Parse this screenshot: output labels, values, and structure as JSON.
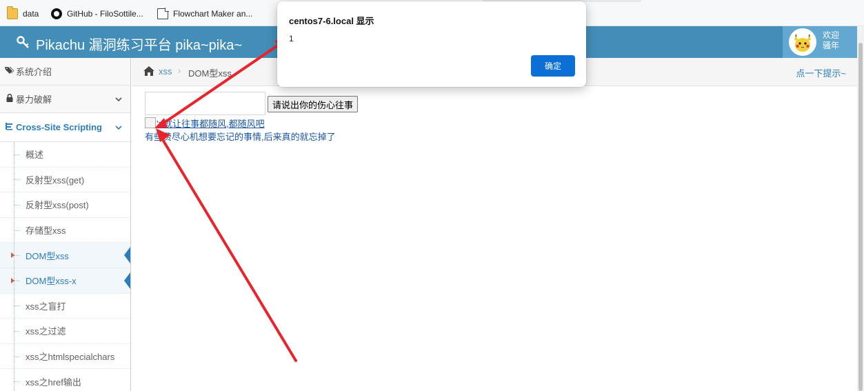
{
  "bookmarks": [
    {
      "label": "data",
      "icon": "folder-icon"
    },
    {
      "label": "GitHub - FiloSottile...",
      "icon": "github-icon"
    },
    {
      "label": "Flowchart Maker an...",
      "icon": "document-icon"
    }
  ],
  "header": {
    "title": "Pikachu 漏洞练习平台 pika~pika~",
    "welcome": "欢迎",
    "user": "骚年",
    "brand_color": "#438eb9"
  },
  "sidebar": {
    "top_items": [
      {
        "label": "系统介绍",
        "icon": "tags-icon"
      },
      {
        "label": "暴力破解",
        "icon": "lock-icon"
      },
      {
        "label": "Cross-Site Scripting",
        "icon": "xss-icon"
      }
    ],
    "sub_items": [
      "概述",
      "反射型xss(get)",
      "反射型xss(post)",
      "存储型xss",
      "DOM型xss",
      "DOM型xss-x",
      "xss之盲打",
      "xss之过滤",
      "xss之htmlspecialchars",
      "xss之href输出"
    ]
  },
  "breadcrumb": {
    "parent": "xss",
    "current": "DOM型xss",
    "hint": "点一下提示~"
  },
  "content": {
    "input_value": "",
    "submit_label": "请说出你的伤心往事",
    "link_text": "'>就让往事都随风,都随风吧",
    "message": "有些费尽心机想要忘记的事情,后来真的就忘掉了"
  },
  "dialog": {
    "title": "centos7-6.local 显示",
    "message": "1",
    "ok_label": "确定",
    "ok_color": "#0b6fd6"
  },
  "annotation": {
    "arrow_color": "#e8252c"
  }
}
